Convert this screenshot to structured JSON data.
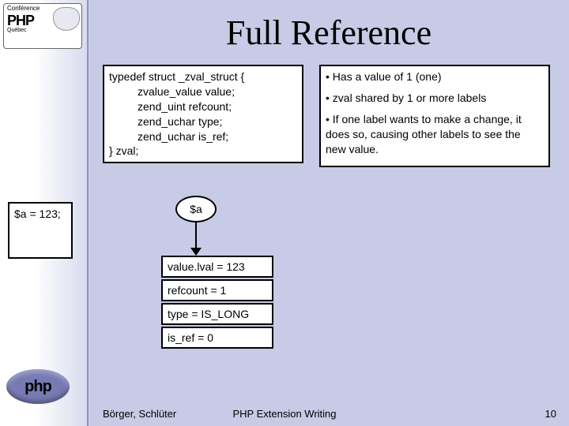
{
  "logo_top": {
    "conference": "Conférence",
    "php": "PHP",
    "region": "Québec"
  },
  "logo_bottom": {
    "text": "php"
  },
  "title": "Full Reference",
  "code": {
    "l1": "typedef struct _zval_struct {",
    "l2": "zvalue_value value;",
    "l3": "zend_uint refcount;",
    "l4": "zend_uchar type;",
    "l5": "zend_uchar is_ref;",
    "l6": "} zval;"
  },
  "notes": {
    "n1": "• Has a value of 1 (one)",
    "n2": "• zval shared by 1 or more labels",
    "n3": "• If one label wants to make a change, it does so, causing other labels to see the new value."
  },
  "assignment": "$a = 123;",
  "var_label": "$a",
  "zval_cells": {
    "value": "value.lval = 123",
    "refcount": "refcount = 1",
    "type": "type = IS_LONG",
    "is_ref": "is_ref = 0"
  },
  "footer": {
    "authors": "Börger, Schlüter",
    "title": "PHP Extension Writing",
    "page": "10"
  }
}
